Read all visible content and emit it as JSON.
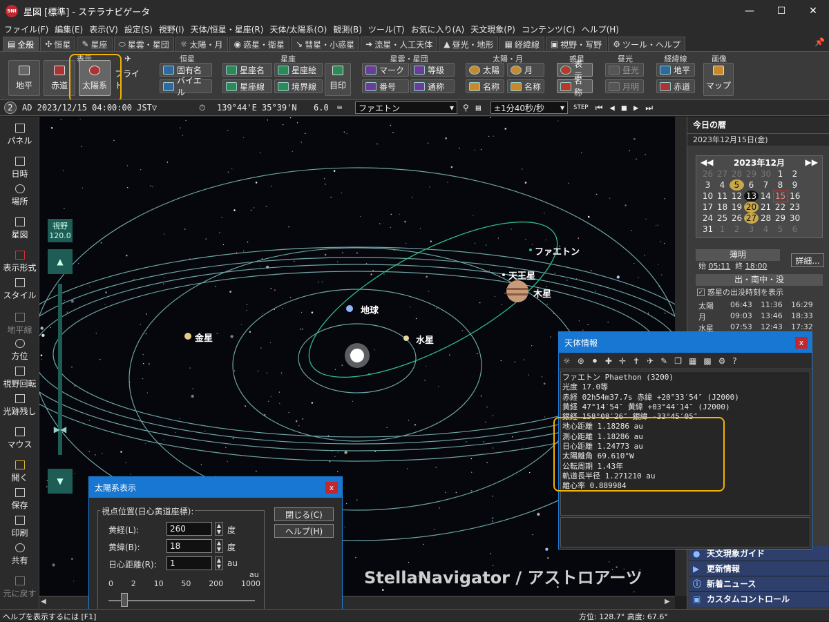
{
  "window": {
    "title": "星図 [標準] - ステラナビゲータ",
    "logo": "SNI"
  },
  "menu": [
    "ファイル(F)",
    "編集(E)",
    "表示(V)",
    "設定(S)",
    "視野(I)",
    "天体/恒星・星座(R)",
    "天体/太陽系(O)",
    "観測(B)",
    "ツール(T)",
    "お気に入り(A)",
    "天文現象(P)",
    "コンテンツ(C)",
    "ヘルプ(H)"
  ],
  "tabs": [
    "全般",
    "恒星",
    "星座",
    "星雲・星団",
    "太陽・月",
    "惑星・衛星",
    "彗星・小惑星",
    "流星・人工天体",
    "昼光・地形",
    "経緯線",
    "視野・写野",
    "ツール・ヘルプ"
  ],
  "ribbon": {
    "groups": {
      "display": "表示",
      "stars": "恒星",
      "constellation": "星座",
      "nebula": "星雲・星団",
      "sunmoon": "太陽・月",
      "planet": "惑星",
      "daylight": "昼光",
      "grid": "経緯線",
      "image": "画像"
    },
    "horizon": "地平",
    "equator": "赤道",
    "solar": "太陽系",
    "flight": "フライト",
    "proper_name": "固有名",
    "bayer": "バイエル",
    "con_name": "星座名",
    "con_art": "星座絵",
    "con_line": "星座線",
    "boundary": "境界線",
    "target": "目印",
    "mark": "マーク",
    "magnitude": "等級",
    "number": "番号",
    "common": "通称",
    "sun": "太陽",
    "moon": "月",
    "sun_name": "名称",
    "moon_name": "名称",
    "planet_show": "表示",
    "planet_name": "名称",
    "daylight": "昼光",
    "moonlight": "月明",
    "alt_az": "地平",
    "equ": "赤道",
    "map": "マップ"
  },
  "status": {
    "num": "2",
    "datetime": "AD 2023/12/15 04:00:00 JST▽",
    "location": "139°44'E 35°39'N",
    "mag": "6.0",
    "target": "ファエトン",
    "step": "±1分40秒/秒"
  },
  "left": [
    "パネル",
    "日時",
    "場所",
    "星図",
    "表示形式",
    "スタイル",
    "地平線",
    "方位",
    "視野回転",
    "光跡残し",
    "マウス",
    "開く",
    "保存",
    "印刷",
    "共有",
    "元に戻す"
  ],
  "fov": {
    "label": "視野",
    "value": "120.0"
  },
  "sky": {
    "labels": {
      "phaethon": "ファエトン",
      "uranus": "天王星",
      "jupiter": "木星",
      "earth": "地球",
      "venus": "金星",
      "mercury": "水星"
    },
    "watermark": "StellaNavigator / アストロアーツ"
  },
  "calendar": {
    "panel_title": "今日の暦",
    "date": "2023年12月15日(金)",
    "month": "2023年12月",
    "rows": [
      [
        "26",
        "27",
        "28",
        "29",
        "30",
        "1",
        "2"
      ],
      [
        "3",
        "4",
        "5",
        "6",
        "7",
        "8",
        "9"
      ],
      [
        "10",
        "11",
        "12",
        "13",
        "14",
        "15",
        "16"
      ],
      [
        "17",
        "18",
        "19",
        "20",
        "21",
        "22",
        "23"
      ],
      [
        "24",
        "25",
        "26",
        "27",
        "28",
        "29",
        "30"
      ],
      [
        "31",
        "1",
        "2",
        "3",
        "4",
        "5",
        "6"
      ]
    ],
    "twilight": "薄明",
    "start_label": "始",
    "start": "05:11",
    "end_label": "終",
    "end": "18:00",
    "detail": "詳細...",
    "rise_header": "出・南中・没",
    "checkbox": "惑星の出没時刻を表示",
    "rise": [
      [
        "太陽",
        "06:43",
        "11:36",
        "16:29"
      ],
      [
        "月",
        "09:03",
        "13:46",
        "18:33"
      ],
      [
        "水星",
        "07:53",
        "12:43",
        "17:32"
      ]
    ]
  },
  "links": [
    "天文現象ガイド",
    "更新情報",
    "新着ニュース",
    "カスタムコントロール"
  ],
  "info": {
    "title": "天体情報",
    "lines": [
      "ファエトン Phaethon (3200)",
      "光度 17.0等",
      "赤経 02h54m37.7s  赤緯 +20°33′54″ (J2000)",
      "黄経  47°14′54″  黄緯 +03°44′14″ (J2000)",
      "銀経 158°08′26″  銀緯 -33°45′05″",
      "地心距離  1.18286 au",
      "測心距離  1.18286 au",
      "日心距離  1.24773 au",
      "太陽離角 69.610°W",
      "公転周期 1.43年",
      "軌道長半径 1.271210 au",
      "離心率 0.889984"
    ]
  },
  "solar_dialog": {
    "title": "太陽系表示",
    "group": "視点位置(日心黄道座標):",
    "lon_label": "黄経(L):",
    "lon": "260",
    "lat_label": "黄緯(B):",
    "lat": "18",
    "dist_label": "日心距離(R):",
    "dist": "1",
    "deg": "度",
    "au": "au",
    "close": "閉じる(C)",
    "help": "ヘルプ(H)",
    "scale": [
      "0",
      "2",
      "10",
      "50",
      "200",
      "1000"
    ]
  },
  "bottom": {
    "help": "ヘルプを表示するには [F1]",
    "azimuth": "方位: 128.7°  高度:  67.6°"
  }
}
